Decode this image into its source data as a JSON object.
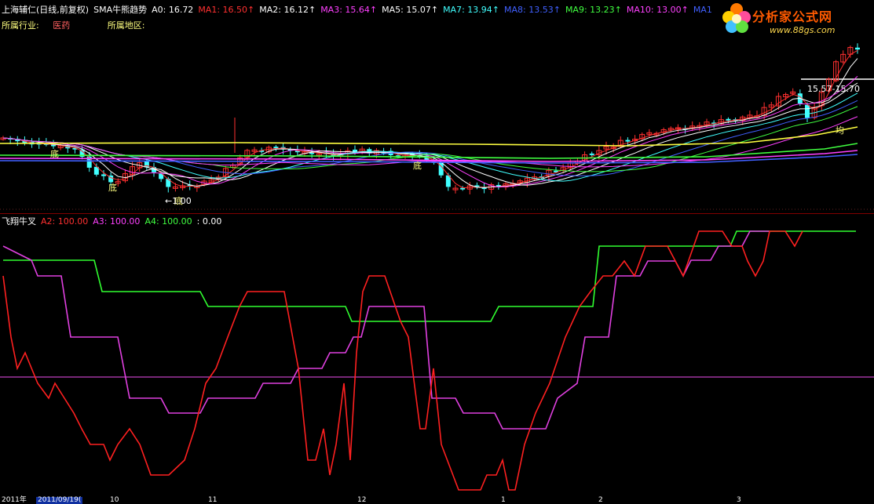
{
  "header": {
    "stock_name": "上海辅仁(日线,前复权)",
    "indicator_name": "SMA牛熊趋势",
    "items": [
      {
        "label": "A0: 16.72",
        "color": "#ffffff"
      },
      {
        "label": "MA1: 16.50↑",
        "color": "#ff3030"
      },
      {
        "label": "MA2: 16.12↑",
        "color": "#ffffff"
      },
      {
        "label": "MA3: 15.64↑",
        "color": "#ff40ff"
      },
      {
        "label": "MA5: 15.07↑",
        "color": "#ffffff"
      },
      {
        "label": "MA7: 13.94↑",
        "color": "#40ffff"
      },
      {
        "label": "MA8: 13.53↑",
        "color": "#4060ff"
      },
      {
        "label": "MA9: 13.23↑",
        "color": "#40ff40"
      },
      {
        "label": "MA10: 13.00↑",
        "color": "#ff40ff"
      },
      {
        "label": "MA1",
        "color": "#4060ff"
      }
    ]
  },
  "info": {
    "industry_label": "所属行业:",
    "industry_value": "医药",
    "region_label": "所属地区:"
  },
  "chart_annotations": {
    "low_marker": "底",
    "low_price": "←1.00",
    "price_range": "15.57-15.70",
    "avg_marker": "均"
  },
  "indicator": {
    "name": "飞翔牛叉",
    "items": [
      {
        "label": "A2: 100.00",
        "color": "#ff3030"
      },
      {
        "label": "A3: 100.00",
        "color": "#ff40ff"
      },
      {
        "label": "A4: 100.00",
        "color": "#40ff40"
      },
      {
        "label": ": 0.00",
        "color": "#ffffff"
      }
    ]
  },
  "logo": {
    "name": "分析家公式网",
    "url": "www.88gs.com"
  },
  "footer": {
    "year": "2011年",
    "date": "2011/09/19(",
    "ticks": [
      "10",
      "11",
      "12",
      "1",
      "2",
      "3"
    ]
  },
  "colors": {
    "up_candle": "#ff3030",
    "down_candle": "#40ffff",
    "a2": "#ff2020",
    "a3": "#e040e0",
    "a4": "#30ff30",
    "yellow_ma": "#ffff40"
  }
}
